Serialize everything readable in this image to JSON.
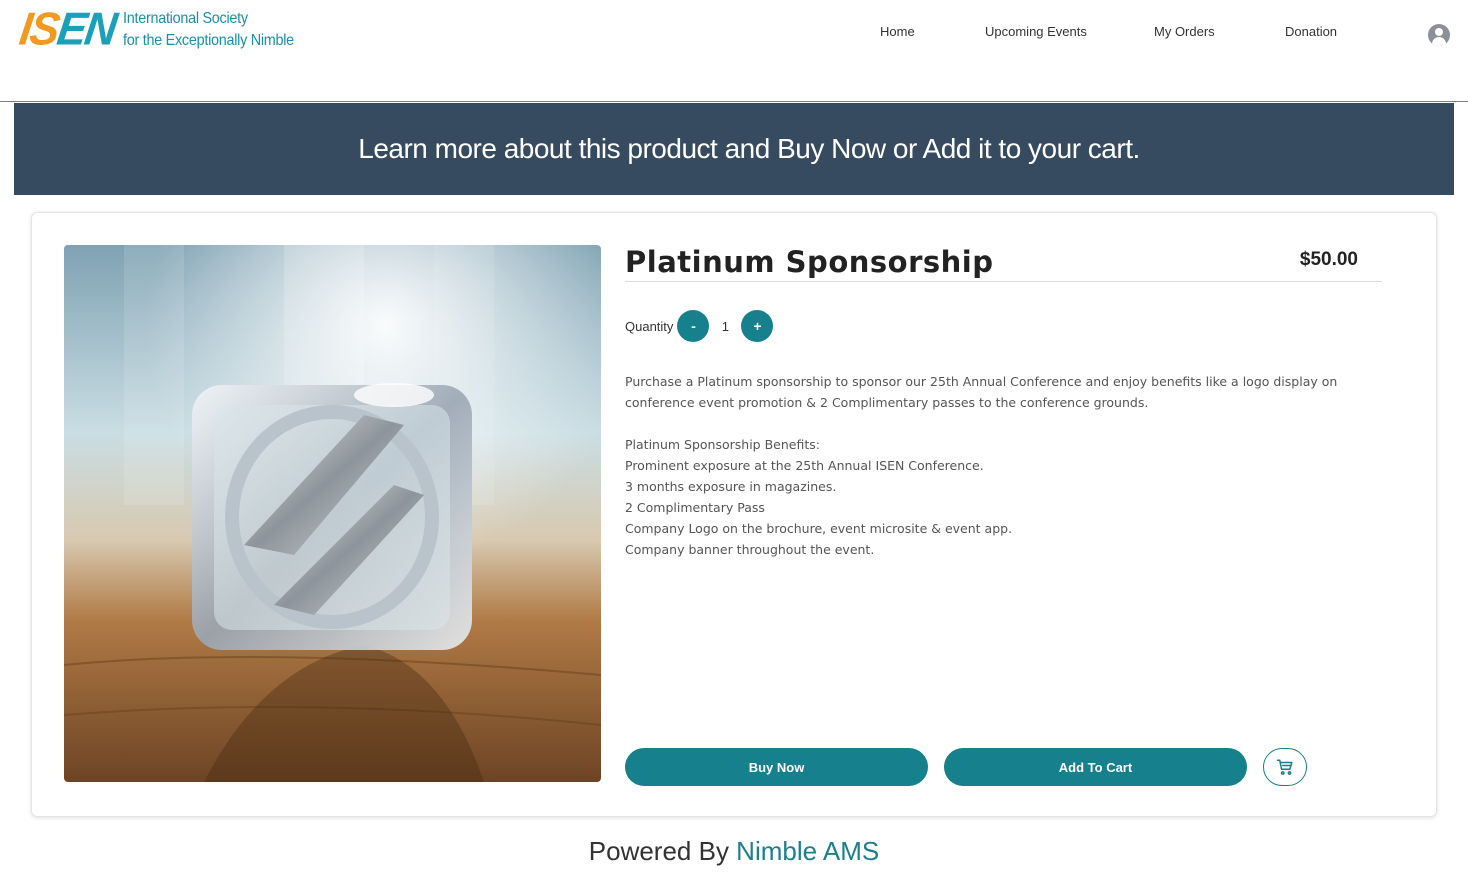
{
  "header": {
    "logo": {
      "mark_left": "IS",
      "mark_right": "EN",
      "line1": "International Society",
      "line2": "for the Exceptionally Nimble"
    },
    "nav": [
      {
        "label": "Home"
      },
      {
        "label": "Upcoming Events"
      },
      {
        "label": "My Orders"
      },
      {
        "label": "Donation"
      }
    ],
    "user_icon": "user-circle-icon"
  },
  "banner": {
    "text": "Learn more about this product and Buy Now or  Add it to your cart."
  },
  "product": {
    "title": "Platinum Sponsorship",
    "price": "$50.00",
    "quantity_label": "Quantity",
    "quantity_value": "1",
    "decrement_label": "-",
    "increment_label": "+",
    "description": [
      "Purchase a Platinum sponsorship to sponsor our 25th Annual Conference and enjoy benefits like a logo display on conference event promotion & 2 Complimentary passes to the conference grounds."
    ],
    "benefits": [
      "Platinum Sponsorship Benefits:",
      "Prominent exposure at the 25th Annual ISEN Conference.",
      "3 months exposure in magazines.",
      "2 Complimentary Pass",
      "Company Logo on the brochure, event microsite & event app.",
      "Company banner throughout the event."
    ],
    "buy_now_label": "Buy Now",
    "add_to_cart_label": "Add To Cart",
    "cart_icon": "shopping-cart-icon"
  },
  "footer": {
    "prefix": "Powered By ",
    "brand": "Nimble AMS"
  },
  "colors": {
    "banner": "#364a60",
    "accent": "#16808c",
    "logo_orange": "#f29a1f",
    "logo_teal": "#1aa0b8"
  }
}
